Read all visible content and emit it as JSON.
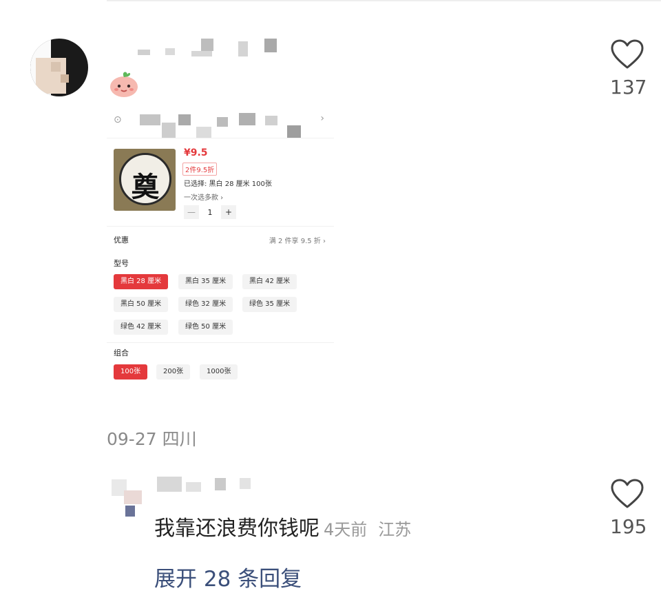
{
  "comment": {
    "likes": "137",
    "product_card": {
      "price": "¥9.5",
      "discount_badge": "2件9.5折",
      "selected_text": "已选择: 黑白 28 厘米 100张",
      "multi_select_text": "一次选多款 ›",
      "quantity": "1",
      "minus": "—",
      "plus": "+",
      "promo_label": "优惠",
      "promo_value": "满 2 件享 9.5 折 ›",
      "model_label": "型号",
      "models": [
        "黑白 28 厘米",
        "黑白 35 厘米",
        "黑白 42 厘米",
        "黑白 50 厘米",
        "绿色 32 厘米",
        "绿色 35 厘米",
        "绿色 42 厘米",
        "绿色 50 厘米"
      ],
      "selected_model_index": 0,
      "combo_label": "组合",
      "combos": [
        "100张",
        "200张",
        "1000张"
      ],
      "selected_combo_index": 0,
      "product_glyph": "奠",
      "accent_color": "#e4393c"
    },
    "date": "09-27",
    "location": "四川"
  },
  "reply": {
    "text": "我靠还浪费你钱呢",
    "time": "4天前",
    "location": "江苏",
    "likes": "195"
  },
  "expand_label": "展开 28 条回复",
  "icons": {
    "like": "heart-outline-icon",
    "location": "location-pin-icon",
    "chevron": "chevron-right-icon",
    "sticker": "peach-face-sticker-icon"
  }
}
